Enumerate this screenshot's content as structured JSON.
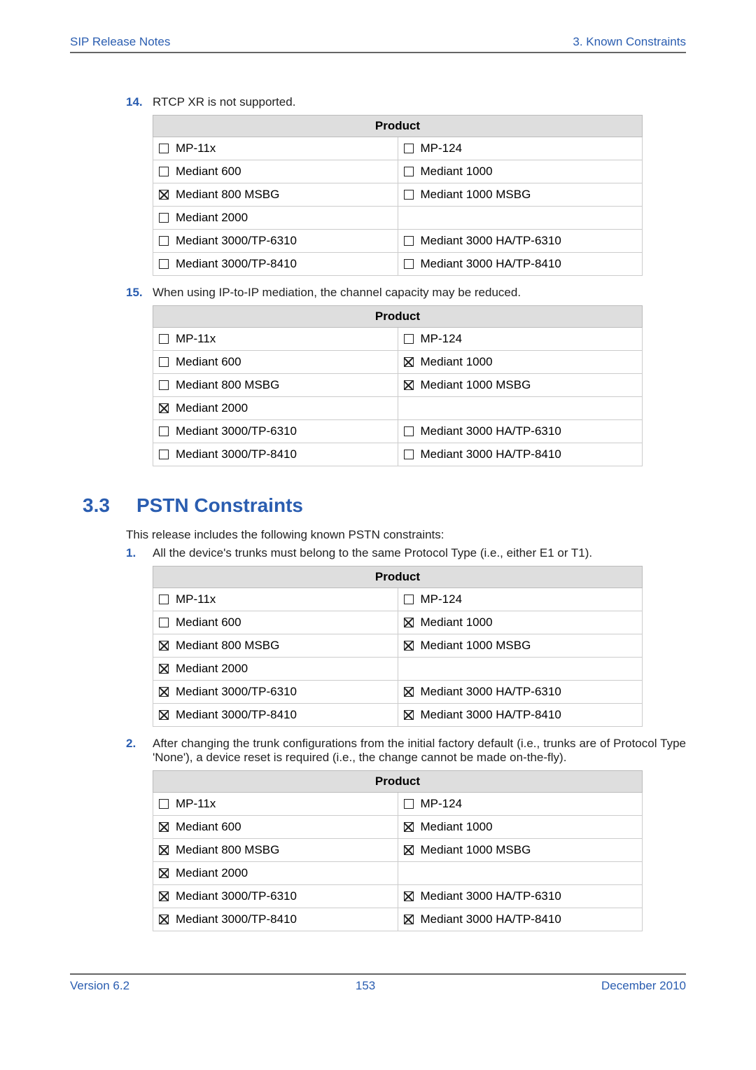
{
  "header": {
    "left": "SIP Release Notes",
    "right": "3. Known Constraints"
  },
  "item14": {
    "num": "14.",
    "text": "RTCP XR is not supported."
  },
  "item15": {
    "num": "15.",
    "text": "When using IP-to-IP mediation, the channel capacity may be reduced."
  },
  "section": {
    "num": "3.3",
    "title": "PSTN Constraints"
  },
  "intro": "This release includes the following known PSTN constraints:",
  "pstn1": {
    "num": "1.",
    "text": "All the device's trunks must belong to the same Protocol Type (i.e., either E1 or T1)."
  },
  "pstn2": {
    "num": "2.",
    "text": "After changing the trunk configurations from the initial factory default (i.e., trunks are of Protocol Type 'None'), a device reset is required (i.e., the change cannot be made on-the-fly)."
  },
  "product_header": "Product",
  "products": {
    "mp11x": "MP-11x",
    "mp124": "MP-124",
    "m600": "Mediant 600",
    "m1000": "Mediant 1000",
    "m800msbg": "Mediant 800 MSBG",
    "m1000msbg": "Mediant 1000 MSBG",
    "m2000": "Mediant 2000",
    "m3000tp6310": "Mediant 3000/TP-6310",
    "m3000ha6310": "Mediant 3000 HA/TP-6310",
    "m3000tp8410": "Mediant 3000/TP-8410",
    "m3000ha8410": "Mediant 3000 HA/TP-8410"
  },
  "tables": {
    "t14": {
      "mp11x": false,
      "mp124": false,
      "m600": false,
      "m1000": false,
      "m800msbg": true,
      "m1000msbg": false,
      "m2000": false,
      "m3000tp6310": false,
      "m3000ha6310": false,
      "m3000tp8410": false,
      "m3000ha8410": false
    },
    "t15": {
      "mp11x": false,
      "mp124": false,
      "m600": false,
      "m1000": true,
      "m800msbg": false,
      "m1000msbg": true,
      "m2000": true,
      "m3000tp6310": false,
      "m3000ha6310": false,
      "m3000tp8410": false,
      "m3000ha8410": false
    },
    "p1": {
      "mp11x": false,
      "mp124": false,
      "m600": false,
      "m1000": true,
      "m800msbg": true,
      "m1000msbg": true,
      "m2000": true,
      "m3000tp6310": true,
      "m3000ha6310": true,
      "m3000tp8410": true,
      "m3000ha8410": true
    },
    "p2": {
      "mp11x": false,
      "mp124": false,
      "m600": true,
      "m1000": true,
      "m800msbg": true,
      "m1000msbg": true,
      "m2000": true,
      "m3000tp6310": true,
      "m3000ha6310": true,
      "m3000tp8410": true,
      "m3000ha8410": true
    }
  },
  "footer": {
    "left": "Version 6.2",
    "center": "153",
    "right": "December 2010"
  }
}
